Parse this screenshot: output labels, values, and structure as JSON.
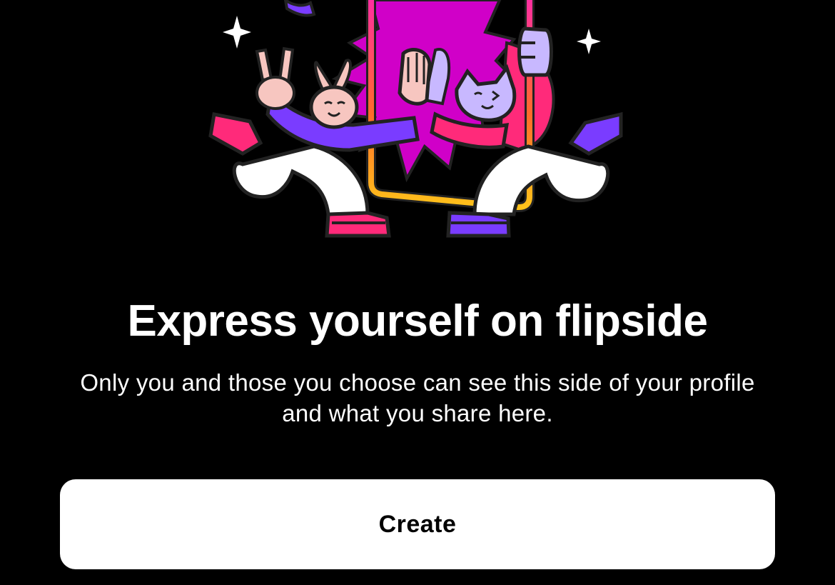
{
  "illustration": {
    "icon": "flipside-characters-illustration",
    "colors": {
      "magenta": "#d000c8",
      "pink": "#ff2a7a",
      "purple": "#7a3cff",
      "lavender": "#c8b8ff",
      "skin": "#f7c6c0",
      "frame_orange": "#ff9a1a",
      "white": "#ffffff"
    }
  },
  "onboarding": {
    "title": "Express yourself on flipside",
    "subtitle": "Only you and those you choose can see this side of your profile and what you share here."
  },
  "actions": {
    "create_label": "Create"
  }
}
